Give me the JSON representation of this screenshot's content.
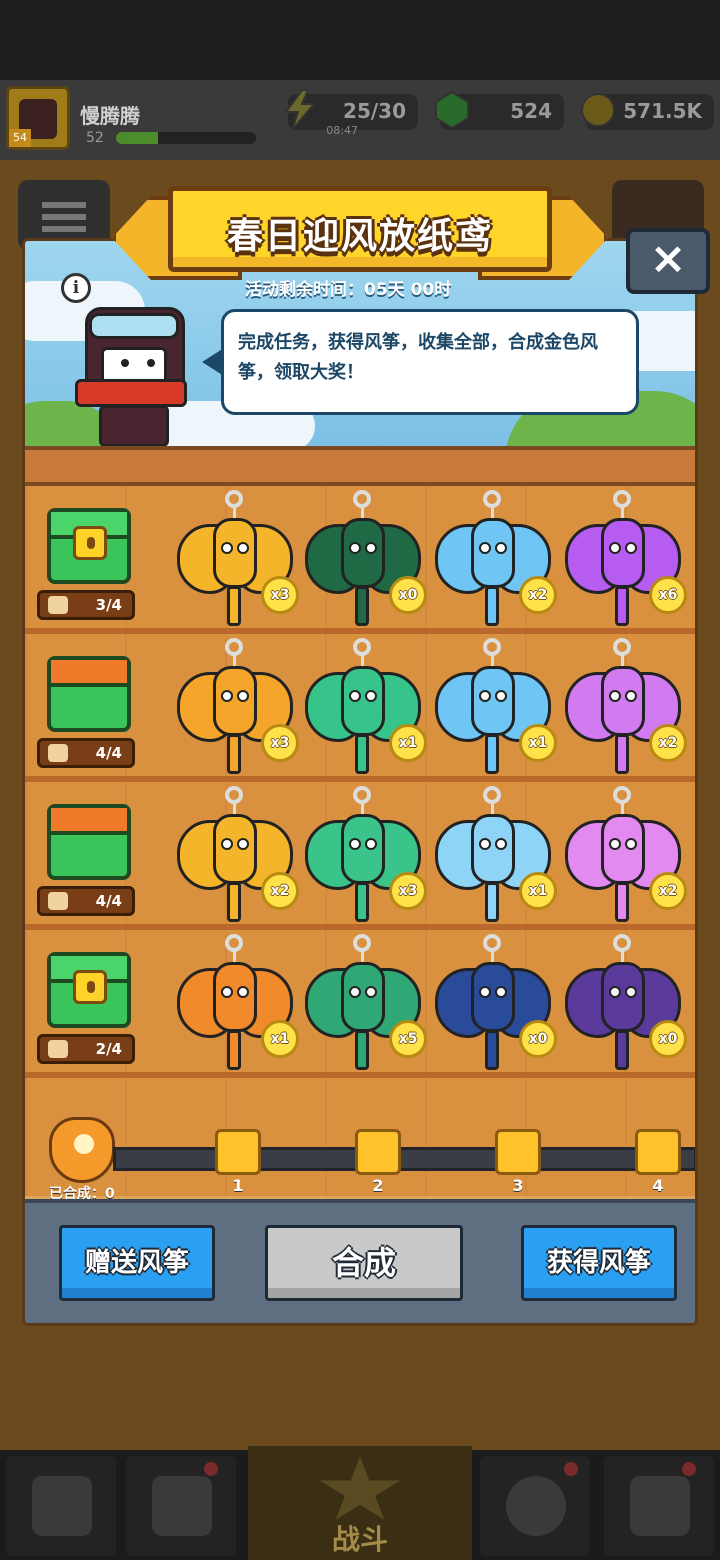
{
  "player": {
    "name": "慢腾腾",
    "level": "52",
    "level_badge": "54",
    "xp_fraction": 0.3
  },
  "resources": {
    "energy": {
      "value": "25/30",
      "timer": "08:47"
    },
    "gems": {
      "value": "524"
    },
    "coins": {
      "value": "571.5K"
    }
  },
  "dialog": {
    "title": "春日迎风放纸鸢",
    "timer_text": "活动剩余时间：05天 00时",
    "info_label": "i",
    "description": "完成任务，获得风筝，收集全部，合成金色风筝，领取大奖！",
    "close_label": "×"
  },
  "rows": [
    {
      "chest_state": "locked",
      "progress": "3/4",
      "kites": [
        {
          "name": "cat-kite-orange",
          "count": "x3",
          "color": "#f5b52a"
        },
        {
          "name": "cat-kite-green",
          "count": "x0",
          "color": "#1f6a44"
        },
        {
          "name": "cat-kite-blue",
          "count": "x2",
          "color": "#6fc6f4"
        },
        {
          "name": "cat-kite-purple",
          "count": "x6",
          "color": "#b65cf0"
        }
      ]
    },
    {
      "chest_state": "open",
      "progress": "4/4",
      "kites": [
        {
          "name": "ladybug-kite-orange",
          "count": "x3",
          "color": "#f5a52a"
        },
        {
          "name": "ladybug-kite-green",
          "count": "x1",
          "color": "#37c48a"
        },
        {
          "name": "ladybug-kite-blue",
          "count": "x1",
          "color": "#6fc6f4"
        },
        {
          "name": "ladybug-kite-purple",
          "count": "x2",
          "color": "#d27af0"
        }
      ]
    },
    {
      "chest_state": "open",
      "progress": "4/4",
      "kites": [
        {
          "name": "butterfly-kite-orange",
          "count": "x2",
          "color": "#f5b52a"
        },
        {
          "name": "butterfly-kite-green",
          "count": "x3",
          "color": "#3ac48a"
        },
        {
          "name": "butterfly-kite-blue",
          "count": "x1",
          "color": "#8ed4f6"
        },
        {
          "name": "butterfly-kite-purple",
          "count": "x2",
          "color": "#e28af0"
        }
      ]
    },
    {
      "chest_state": "locked",
      "progress": "2/4",
      "kites": [
        {
          "name": "swallow-kite-orange",
          "count": "x1",
          "color": "#f08a2a"
        },
        {
          "name": "swallow-kite-green",
          "count": "x5",
          "color": "#2fa876"
        },
        {
          "name": "swallow-kite-blue",
          "count": "x0",
          "color": "#2a4a9a"
        },
        {
          "name": "swallow-kite-purple",
          "count": "x0",
          "color": "#5a3a9a"
        }
      ]
    }
  ],
  "progress": {
    "merged_label": "已合成：0",
    "milestones": [
      "1",
      "2",
      "3",
      "4"
    ]
  },
  "actions": {
    "gift": "赠送风筝",
    "merge": "合成",
    "get": "获得风筝"
  },
  "nav": {
    "battle": "战斗"
  },
  "colors": {
    "wood": "#d9903f",
    "blue_button": "#2b9ff2",
    "ribbon": "#ffd52a"
  }
}
